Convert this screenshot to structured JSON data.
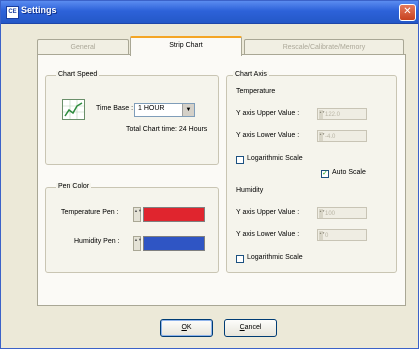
{
  "window": {
    "title": "Settings",
    "icon": "app-logo-icon",
    "close_glyph": "✕"
  },
  "tabs": [
    {
      "label": "General",
      "active": false
    },
    {
      "label": "Strip Chart",
      "active": true
    },
    {
      "label": "Rescale/Calibrate/Memory",
      "active": false
    }
  ],
  "chart_speed": {
    "group_label": "Chart Speed",
    "icon": "line-chart-icon",
    "time_base_label": "Time Base :",
    "time_base_value": "1 HOUR",
    "total_chart_time": "Total Chart time: 24 Hours"
  },
  "pen_color": {
    "group_label": "Pen Color",
    "temperature_label": "Temperature Pen :",
    "temperature_color": "#e0252e",
    "humidity_label": "Humidity Pen :",
    "humidity_color": "#2f55c4"
  },
  "chart_axis": {
    "group_label": "Chart Axis",
    "temperature": {
      "title": "Temperature",
      "upper_label": "Y axis Upper Value :",
      "upper_value": "122.0",
      "lower_label": "Y axis Lower Value :",
      "lower_value": "-4.0",
      "log_scale_label": "Logarithmic Scale",
      "log_scale_checked": false,
      "auto_scale_label": "Auto Scale",
      "auto_scale_checked": true
    },
    "humidity": {
      "title": "Humidity",
      "upper_label": "Y axis Upper Value :",
      "upper_value": "100",
      "lower_label": "Y axis Lower Value :",
      "lower_value": "0",
      "log_scale_label": "Logarithmic Scale",
      "log_scale_checked": false
    }
  },
  "buttons": {
    "ok_accel": "O",
    "ok_rest": "K",
    "cancel_accel": "C",
    "cancel_rest": "ancel"
  },
  "spinner_glyph": "▲▼"
}
